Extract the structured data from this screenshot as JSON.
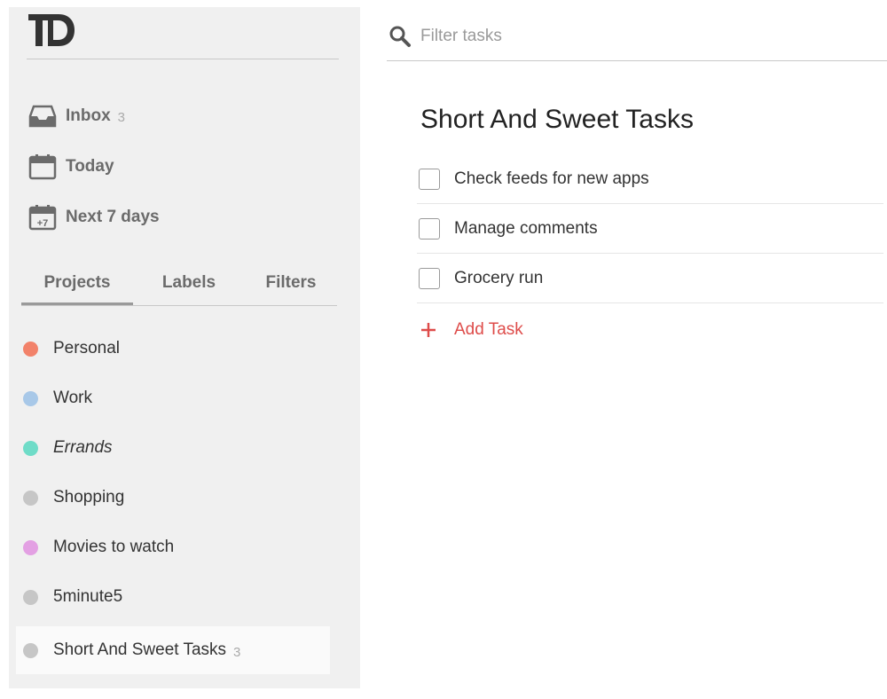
{
  "app": {
    "logo_text": "TD"
  },
  "nav": {
    "inbox": {
      "label": "Inbox",
      "count": "3"
    },
    "today": {
      "label": "Today"
    },
    "next7": {
      "label": "Next 7 days",
      "icon_badge": "+7"
    }
  },
  "tabs": [
    {
      "label": "Projects",
      "active": true
    },
    {
      "label": "Labels",
      "active": false
    },
    {
      "label": "Filters",
      "active": false
    }
  ],
  "projects": [
    {
      "label": "Personal",
      "color": "#f2826a"
    },
    {
      "label": "Work",
      "color": "#a8c8e8"
    },
    {
      "label": "Errands",
      "color": "#6fdcc8"
    },
    {
      "label": "Shopping",
      "color": "#c6c6c6"
    },
    {
      "label": "Movies to watch",
      "color": "#e3a0e3"
    },
    {
      "label": "5minute5",
      "color": "#c6c6c6"
    },
    {
      "label": "Short And Sweet Tasks",
      "color": "#c6c6c6",
      "count": "3",
      "selected": true
    }
  ],
  "search": {
    "placeholder": "Filter tasks",
    "value": ""
  },
  "main": {
    "title": "Short And Sweet Tasks",
    "tasks": [
      {
        "label": "Check feeds for new apps",
        "done": false
      },
      {
        "label": "Manage comments",
        "done": false
      },
      {
        "label": "Grocery run",
        "done": false
      }
    ],
    "add_task_label": "Add Task"
  },
  "colors": {
    "accent": "#de4c4a",
    "sidebar_bg": "#f0f0f0"
  }
}
